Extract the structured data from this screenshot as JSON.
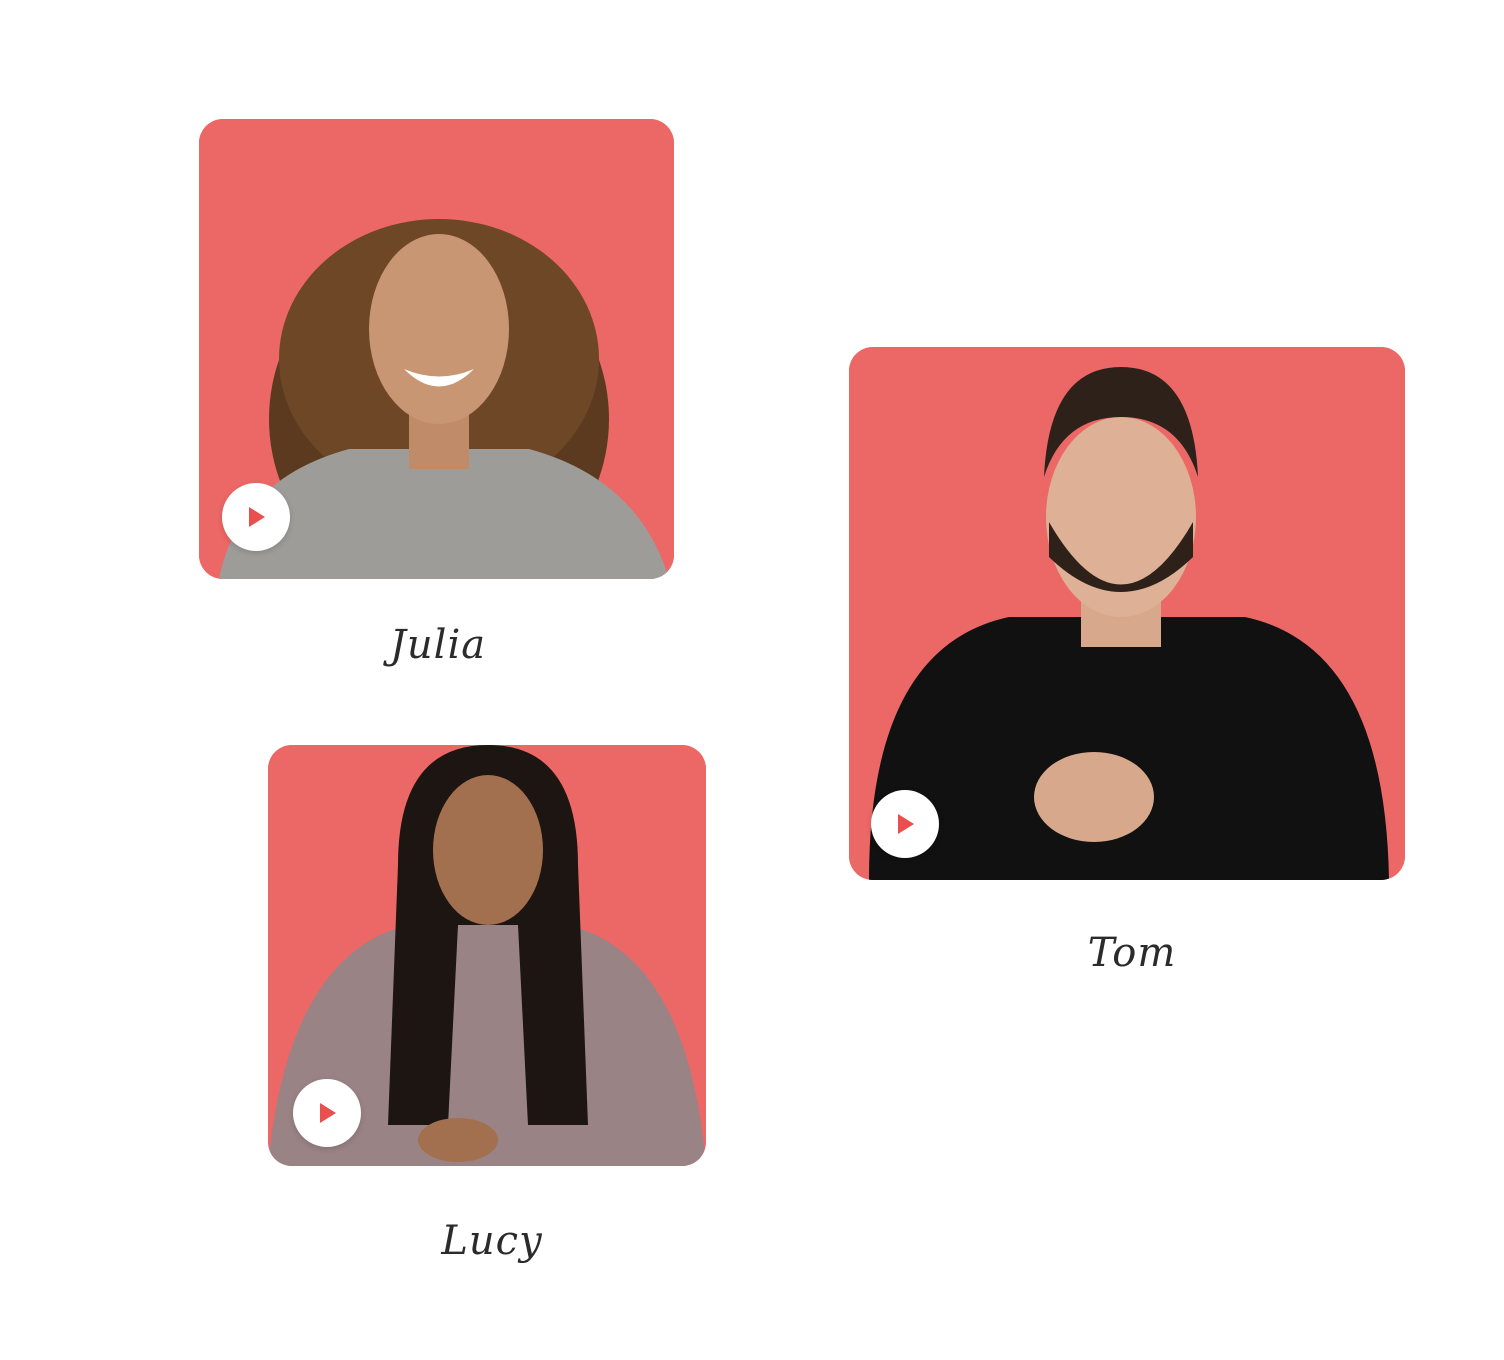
{
  "people": [
    {
      "name": "Julia",
      "play_icon": "play-icon"
    },
    {
      "name": "Tom",
      "play_icon": "play-icon"
    },
    {
      "name": "Lucy",
      "play_icon": "play-icon"
    }
  ],
  "colors": {
    "card_background": "#ec6866",
    "page_background": "#ffffff",
    "name_text": "#2b2b2b",
    "play_icon": "#ea4f4f",
    "play_button": "#ffffff"
  }
}
